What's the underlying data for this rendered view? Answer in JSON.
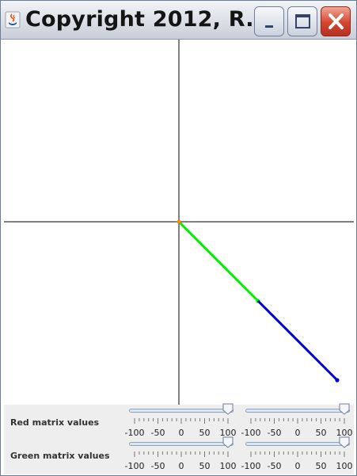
{
  "window": {
    "title": "Copyright 2012, R...",
    "buttons": {
      "minimize": "minimize",
      "maximize": "maximize",
      "close": "close"
    }
  },
  "plot": {
    "origin": [
      0,
      0
    ],
    "vectors": [
      {
        "name": "green",
        "color": "#00ee00",
        "from": [
          0,
          0
        ],
        "to": [
          100,
          -100
        ]
      },
      {
        "name": "blue",
        "color": "#0000cc",
        "from": [
          100,
          -100
        ],
        "to": [
          200,
          -200
        ]
      }
    ],
    "axis_color": "#000000",
    "origin_dot_color": "#ff8800"
  },
  "controls": {
    "red_label": "Red matrix values",
    "green_label": "Green matrix values",
    "slider_ticks": [
      "-100",
      "-50",
      "0",
      "50",
      "100"
    ],
    "sliders": [
      {
        "name": "red-slider-1",
        "min": -100,
        "max": 100,
        "value": 100
      },
      {
        "name": "red-slider-2",
        "min": -100,
        "max": 100,
        "value": 100
      },
      {
        "name": "green-slider-1",
        "min": -100,
        "max": 100,
        "value": 100
      },
      {
        "name": "green-slider-2",
        "min": -100,
        "max": 100,
        "value": 100
      }
    ]
  }
}
